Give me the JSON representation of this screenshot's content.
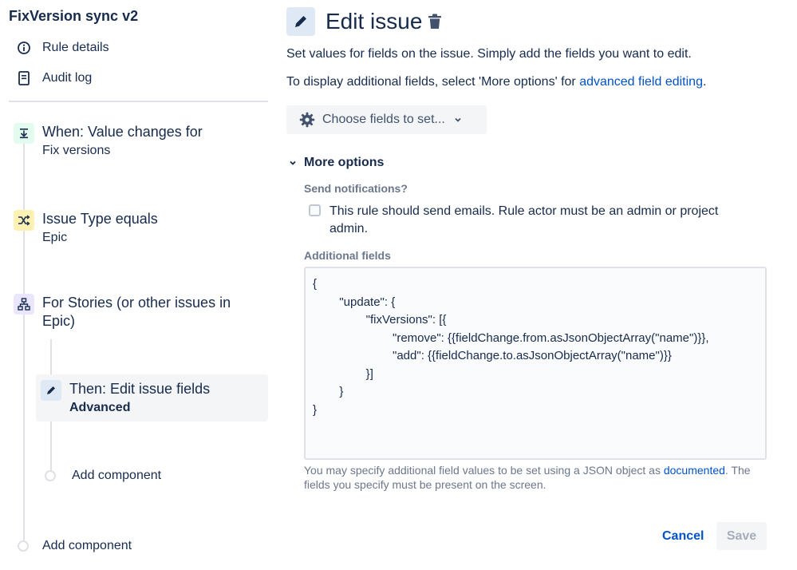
{
  "sidebar": {
    "rule_title": "FixVersion sync v2",
    "links": [
      {
        "label": "Rule details",
        "icon": "info-icon"
      },
      {
        "label": "Audit log",
        "icon": "document-icon"
      }
    ],
    "steps": [
      {
        "title": "When: Value changes for",
        "subtitle": "Fix versions",
        "icon": "trigger-icon",
        "color": "#e3fcef"
      },
      {
        "title": "Issue Type equals",
        "subtitle": "Epic",
        "icon": "condition-icon",
        "color": "#fff0b3"
      },
      {
        "title": "For Stories (or other issues in Epic)",
        "icon": "branch-icon",
        "color": "#eae6ff"
      },
      {
        "title": "Then: Edit issue fields",
        "subtitle": "Advanced",
        "icon": "pencil-icon",
        "color": "#dfe8f5"
      }
    ],
    "add_component_inner": "Add component",
    "add_component_outer": "Add component"
  },
  "main": {
    "title": "Edit issue",
    "description": "Set values for fields on the issue. Simply add the fields you want to edit.",
    "more_fields_prefix": "To display additional fields, select 'More options' for ",
    "more_fields_link": "advanced field editing",
    "more_fields_suffix": ".",
    "choose_fields_label": "Choose fields to set...",
    "more_options_label": "More options",
    "send_notifications_label": "Send notifications?",
    "send_notifications_checkbox": "This rule should send emails. Rule actor must be an admin or project admin.",
    "send_notifications_checked": false,
    "additional_fields_label": "Additional fields",
    "additional_fields_value": "{\n        \"update\": {\n                \"fixVersions\": [{\n                        \"remove\": {{fieldChange.from.asJsonObjectArray(\"name\")}},\n                        \"add\": {{fieldChange.to.asJsonObjectArray(\"name\")}}\n                }]\n        }\n}",
    "help_prefix": "You may specify additional field values to be set using a JSON object as ",
    "help_link": "documented",
    "help_suffix": ". The fields you specify must be present on the screen.",
    "cancel_label": "Cancel",
    "save_label": "Save"
  },
  "colors": {
    "link": "#0052cc",
    "text": "#172b4d",
    "muted": "#6b778c",
    "selected_step_bg": "#f4f5f7"
  }
}
